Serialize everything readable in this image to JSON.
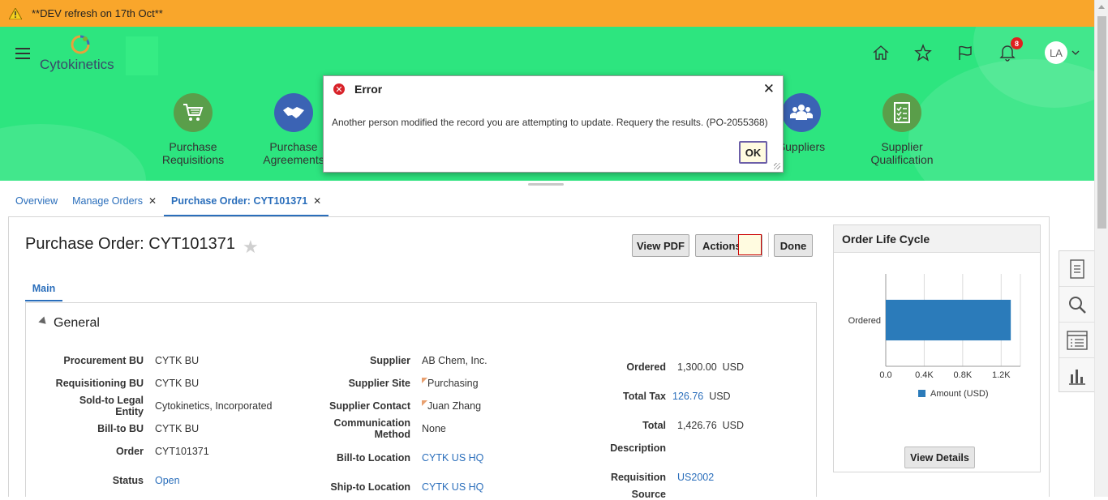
{
  "banner": {
    "text": "**DEV refresh on 17th Oct**"
  },
  "header": {
    "logo_text": "Cytokinetics",
    "notifications_count": "8",
    "user_initials": "LA",
    "apps": [
      {
        "label_line1": "Purchase",
        "label_line2": "Requisitions",
        "icon": "cart-icon"
      },
      {
        "label_line1": "Purchase",
        "label_line2": "Agreements",
        "icon": "handshake-icon"
      },
      {
        "label_line1": "Suppliers",
        "label_line2": "",
        "icon": "people-icon"
      },
      {
        "label_line1": "Supplier",
        "label_line2": "Qualification",
        "icon": "checklist-icon"
      }
    ]
  },
  "tabs": [
    {
      "label": "Overview",
      "closable": false
    },
    {
      "label": "Manage Orders",
      "closable": true
    },
    {
      "label": "Purchase Order: CYT101371",
      "closable": true
    }
  ],
  "page": {
    "title": "Purchase Order: CYT101371",
    "view_pdf": "View PDF",
    "actions": "Actions",
    "done": "Done",
    "main_tab": "Main",
    "section_title": "General"
  },
  "general": {
    "col1": [
      {
        "label": "Procurement BU",
        "value": "CYTK BU"
      },
      {
        "label": "Requisitioning BU",
        "value": "CYTK BU"
      },
      {
        "label": "Sold-to Legal Entity",
        "label_line1": "Sold-to Legal",
        "label_line2": "Entity",
        "value": "Cytokinetics, Incorporated"
      },
      {
        "label": "Bill-to BU",
        "value": "CYTK BU"
      },
      {
        "label": "Order",
        "value": "CYT101371"
      },
      {
        "label": "Status",
        "value": "Open"
      }
    ],
    "col2": [
      {
        "label": "Supplier",
        "value": "AB Chem, Inc."
      },
      {
        "label": "Supplier Site",
        "value": "Purchasing"
      },
      {
        "label": "Supplier Contact",
        "value": "Juan Zhang"
      },
      {
        "label_line1": "Communication",
        "label_line2": "Method",
        "value": "None"
      },
      {
        "label": "Bill-to Location",
        "value": "CYTK US HQ"
      },
      {
        "label": "Ship-to Location",
        "value": "CYTK US HQ"
      }
    ],
    "col3": [
      {
        "label": "Ordered",
        "value": "1,300.00",
        "unit": "USD"
      },
      {
        "label": "Total Tax",
        "value": "126.76",
        "unit": "USD"
      },
      {
        "label": "Total",
        "value": "1,426.76",
        "unit": "USD"
      },
      {
        "label": "Description",
        "value": ""
      },
      {
        "label": "Requisition",
        "value": "US2002"
      },
      {
        "label": "Source",
        "value": ""
      }
    ]
  },
  "lifecycle": {
    "title": "Order Life Cycle",
    "view_details": "View Details",
    "chart_data": {
      "type": "bar",
      "orientation": "horizontal",
      "categories": [
        "Ordered"
      ],
      "series": [
        {
          "name": "Amount (USD)",
          "values": [
            1300
          ]
        }
      ],
      "xlim": [
        0,
        1400
      ],
      "ticks": [
        "0.0",
        "0.4K",
        "0.8K",
        "1.2K"
      ],
      "legend": "bottom",
      "color": "#2b7bba"
    }
  },
  "dialog": {
    "title": "Error",
    "message": "Another person modified the record you are attempting to update. Requery the results. (PO-2055368)",
    "ok": "OK"
  }
}
